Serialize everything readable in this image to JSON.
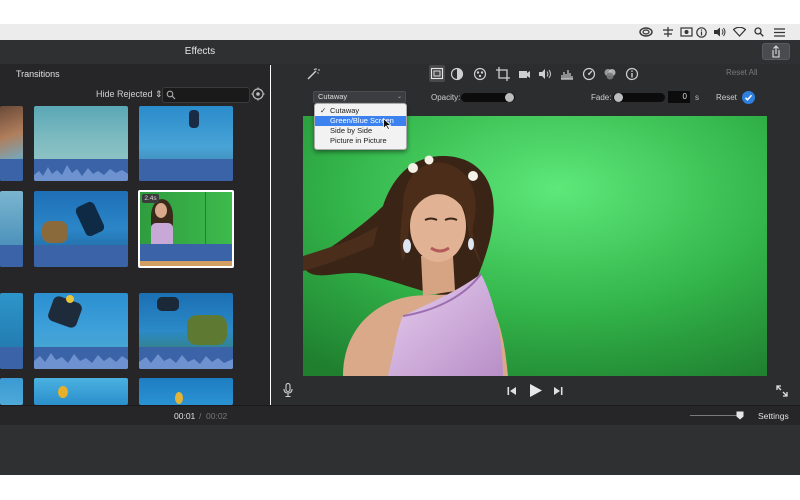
{
  "toolbar": {
    "title": "Effects"
  },
  "browser": {
    "section_label": "Transitions",
    "filter_label": "Hide Rejected",
    "selected_clip_duration": "2.4s"
  },
  "adjust": {
    "reset_all": "Reset All",
    "overlay_style": "Cutaway",
    "opacity_label": "Opacity:",
    "fade_label": "Fade:",
    "fade_value": "0",
    "fade_unit": "s",
    "reset_label": "Reset",
    "opacity_level": 1.0,
    "fade_level": 0.0
  },
  "dropdown": {
    "items": [
      {
        "label": "Cutaway",
        "checked": true
      },
      {
        "label": "Green/Blue Screen",
        "highlighted": true
      },
      {
        "label": "Side by Side"
      },
      {
        "label": "Picture in Picture"
      }
    ]
  },
  "status": {
    "current_time": "00:01",
    "separator": "/",
    "total_time": "00:02",
    "settings_label": "Settings"
  },
  "icons": {
    "menubar": [
      "creative-cloud-icon",
      "network-icon",
      "screen-icon",
      "info-icon",
      "volume-icon",
      "wifi-icon",
      "search-icon",
      "list-icon"
    ],
    "tools": [
      "magic-wand-icon",
      "video-overlay-icon",
      "color-balance-icon",
      "color-correction-icon",
      "crop-icon",
      "stabilization-icon",
      "volume-icon",
      "noise-reduction-icon",
      "speed-icon",
      "clip-filter-icon",
      "info-icon"
    ]
  },
  "colors": {
    "accent": "#3b82f0",
    "waveform": "#3b63a7",
    "green_screen": "#2ea83c"
  }
}
